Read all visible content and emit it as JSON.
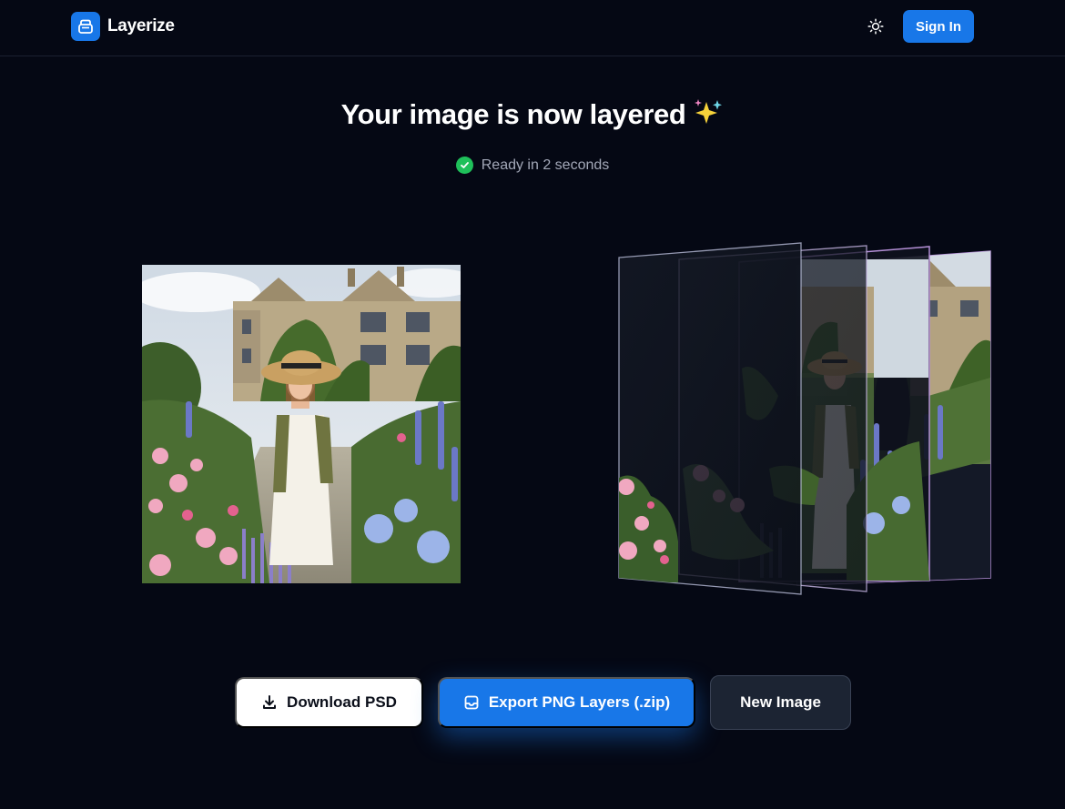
{
  "header": {
    "brand_name": "Layerize",
    "signin_label": "Sign In"
  },
  "main": {
    "title": "Your image is now layered",
    "title_emoji": "sparkles-icon",
    "status_text": "Ready in 2 seconds"
  },
  "actions": {
    "download_psd_label": "Download PSD",
    "export_png_label": "Export PNG Layers (.zip)",
    "new_image_label": "New Image"
  },
  "icons": {
    "logo": "layers-logo-icon",
    "theme": "sun-icon",
    "status": "check-circle-icon",
    "download": "download-icon",
    "export": "archive-box-icon"
  },
  "colors": {
    "background": "#050814",
    "accent": "#1877e8",
    "success": "#1fc05a",
    "layer_outline": "#b48fd6"
  }
}
